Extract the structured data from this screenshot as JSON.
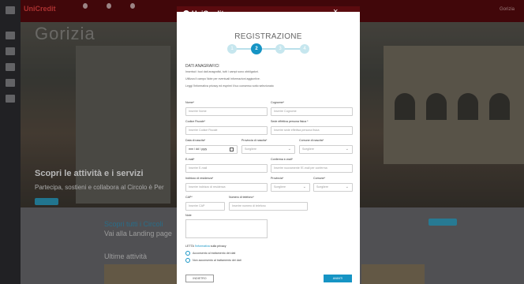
{
  "background": {
    "brand": "UniCredit",
    "city_title": "Gorizia",
    "hero_title": "Scopri le attività e i servizi",
    "hero_subtitle": "Partecipa, sostieni e collabora al Circolo è Per",
    "lower_link": "Scopri tutti i Circoli",
    "lower_text": "Vai alla Landing page",
    "lower_section": "Ultime attività",
    "top_right": "Gorizia"
  },
  "modal": {
    "brand": "UniCredit",
    "close": "×",
    "title": "REGISTRAZIONE",
    "steps": [
      "1",
      "2",
      "3",
      "4"
    ],
    "active_step": 2,
    "section_title": "DATI ANAGRAFICI",
    "info_lines": [
      "Inserisci i tuoi dati anagrafici, tutti i campi sono obbligatori.",
      "Utilizza il campo Note per eventuali informazioni aggiuntive.",
      "Leggi l'informativa privacy ed esprimi il tuo consenso sotto selezionato"
    ],
    "fields": {
      "nome": {
        "label": "Nome*",
        "placeholder": "Inserire Nome"
      },
      "cognome": {
        "label": "Cognome*",
        "placeholder": "Inserire Cognome"
      },
      "codice_fiscale": {
        "label": "Codice Fiscale*",
        "placeholder": "Inserire Codice Fiscale"
      },
      "sede": {
        "label": "Sede effettiva persona fisica *",
        "placeholder": "Inserire sede effettiva persona fisica"
      },
      "data_nascita": {
        "label": "Data di nascita*",
        "value": "mm / dd / yyyy"
      },
      "provincia_nascita": {
        "label": "Provincia di nascita*",
        "value": "Scegliere"
      },
      "comune_nascita": {
        "label": "Comune di nascita*",
        "value": "Scegliere"
      },
      "email": {
        "label": "E-mail*",
        "placeholder": "Inserire E-mail"
      },
      "conferma_email": {
        "label": "Conferma e-mail*",
        "placeholder": "Inserire nuovamente l'E-mail per conferma"
      },
      "indirizzo": {
        "label": "Indirizzo di residenza*",
        "placeholder": "Inserire indirizzo di residenza"
      },
      "provincia": {
        "label": "Provincia*",
        "value": "Scegliere"
      },
      "comune": {
        "label": "Comune*",
        "value": "Scegliere"
      },
      "cap": {
        "label": "CAP*",
        "placeholder": "Inserire CAP"
      },
      "telefono": {
        "label": "Numero di telefono*",
        "placeholder": "Inserire numero di telefono"
      },
      "note": {
        "label": "Note"
      }
    },
    "privacy_prefix": "LETTA ",
    "privacy_link": "l'informativa",
    "privacy_suffix": " sulla privacy",
    "radio_accept": "Acconsento al trattamento dei dati",
    "radio_decline": "Non acconsento al trattamento dei dati",
    "back_label": "INDIETRO",
    "next_label": "AVANTI"
  }
}
